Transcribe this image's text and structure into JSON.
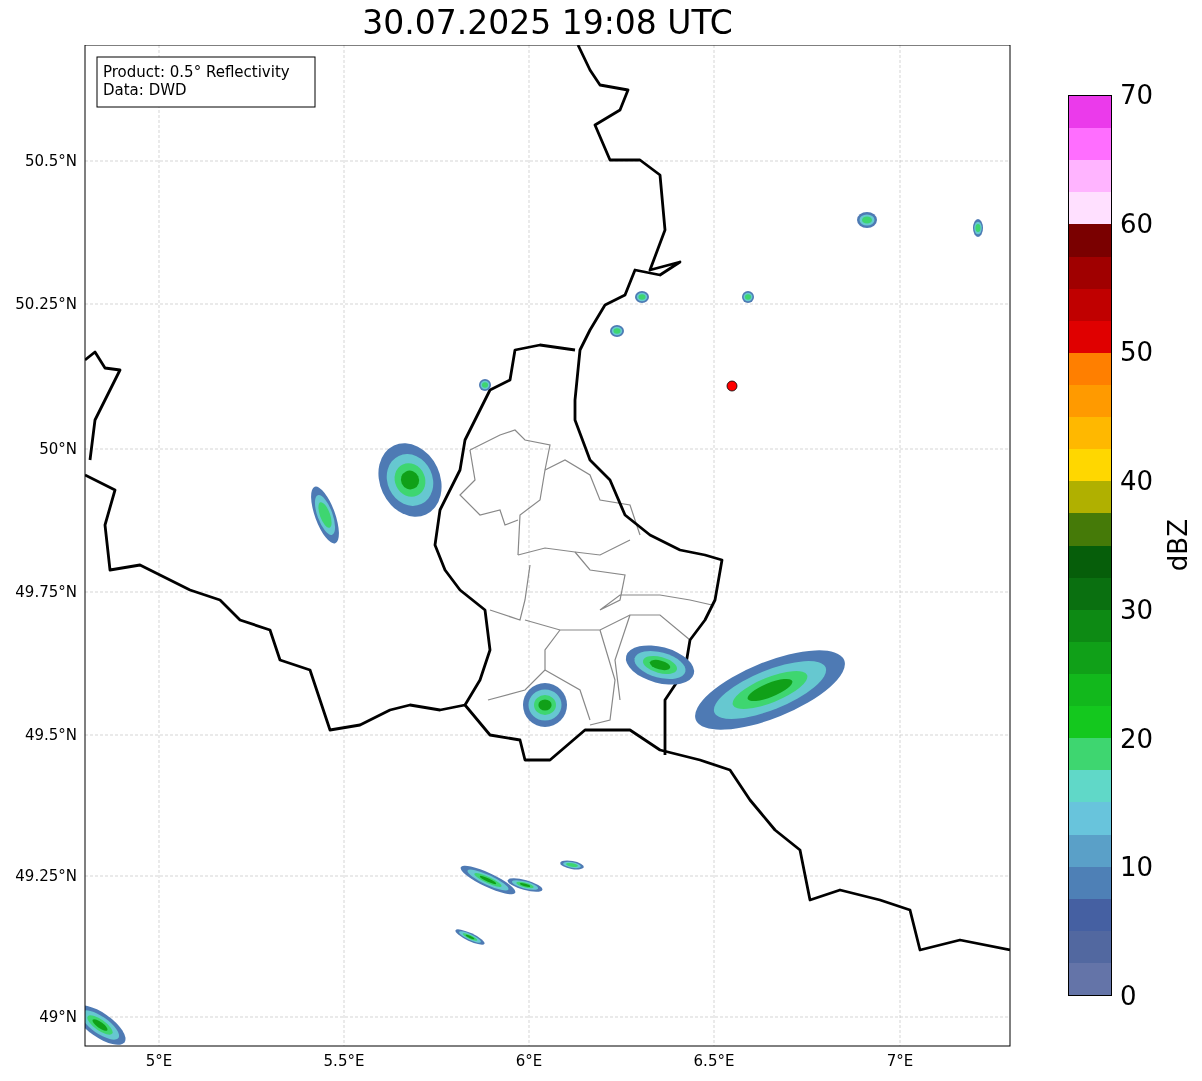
{
  "title": "30.07.2025 19:08 UTC",
  "info_box": [
    "Product: 0.5° Reflectivity",
    "Data: DWD"
  ],
  "map": {
    "lon_ticks": [
      "5°E",
      "5.5°E",
      "6°E",
      "6.5°E",
      "7°E"
    ],
    "lat_ticks": [
      "50.5°N",
      "50.25°N",
      "50°N",
      "49.75°N",
      "49.5°N",
      "49.25°N",
      "49°N"
    ]
  },
  "colorbar": {
    "label": "dBZ",
    "ticks": [
      "70",
      "60",
      "50",
      "40",
      "30",
      "20",
      "10",
      "0"
    ],
    "segments": [
      {
        "color": "#eb3aeb"
      },
      {
        "color": "#ff6eff"
      },
      {
        "color": "#ffb4ff"
      },
      {
        "color": "#ffe0ff"
      },
      {
        "color": "#7a0000"
      },
      {
        "color": "#a00000"
      },
      {
        "color": "#c00000"
      },
      {
        "color": "#e00000"
      },
      {
        "color": "#ff7f00"
      },
      {
        "color": "#ff9a00"
      },
      {
        "color": "#ffb800"
      },
      {
        "color": "#ffd700"
      },
      {
        "color": "#b0b000"
      },
      {
        "color": "#457a08"
      },
      {
        "color": "#065e0a"
      },
      {
        "color": "#0a7010"
      },
      {
        "color": "#0d8a14"
      },
      {
        "color": "#10a018"
      },
      {
        "color": "#12b81c"
      },
      {
        "color": "#14c81e"
      },
      {
        "color": "#3ed670"
      },
      {
        "color": "#60d8c8"
      },
      {
        "color": "#68c4dc"
      },
      {
        "color": "#5aa0c8"
      },
      {
        "color": "#4e80b6"
      },
      {
        "color": "#4560a2"
      },
      {
        "color": "#5268a0"
      },
      {
        "color": "#6474a8"
      }
    ]
  }
}
